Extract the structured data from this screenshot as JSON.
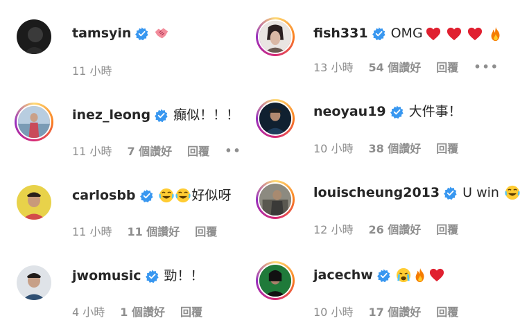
{
  "colors": {
    "verified": "#3897f0",
    "meta": "#8e8e8e",
    "heart": "#e02030"
  },
  "comments": [
    {
      "user": "tamsyin",
      "text": "",
      "time": "11 小時",
      "likes": "",
      "reply": ""
    },
    {
      "user": "fish331",
      "text": "OMG",
      "time": "13 小時",
      "likes": "54 個讚好",
      "reply": "回覆",
      "more": "•••"
    },
    {
      "user": "inez_leong",
      "text": "癲似！！！",
      "time": "11 小時",
      "likes": "7 個讚好",
      "reply": "回覆",
      "more": "••"
    },
    {
      "user": "neoyau19",
      "text": "大件事！",
      "time": "10 小時",
      "likes": "38 個讚好",
      "reply": "回覆"
    },
    {
      "user": "carlosbb",
      "text": "好似呀",
      "time": "11 小時",
      "likes": "11 個讚好",
      "reply": "回覆"
    },
    {
      "user": "louischeung2013",
      "text": "U win",
      "time": "12 小時",
      "likes": "26 個讚好",
      "reply": "回覆"
    },
    {
      "user": "jwomusic",
      "text": "勁！！",
      "time": "4 小時",
      "likes": "1 個讚好",
      "reply": "回覆"
    },
    {
      "user": "jacechw",
      "text": "",
      "time": "10 小時",
      "likes": "17 個讚好",
      "reply": "回覆"
    }
  ]
}
